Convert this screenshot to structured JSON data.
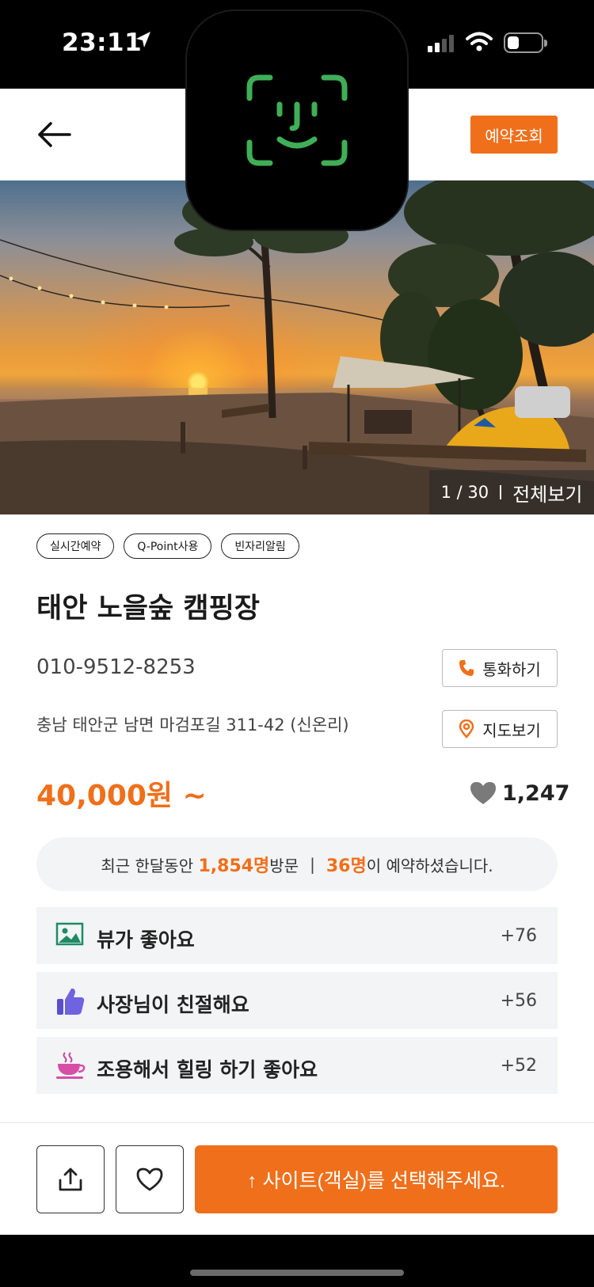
{
  "status_bar": {
    "time": "23:11"
  },
  "header": {
    "reserve_label": "예약조회"
  },
  "gallery": {
    "counter": "1 / 30",
    "view_all": "전체보기"
  },
  "tags": [
    "실시간예약",
    "Q-Point사용",
    "빈자리알림"
  ],
  "place": {
    "title": "태안 노을숲 캠핑장",
    "phone": "010-9512-8253",
    "call_label": "통화하기",
    "address": "충남 태안군 남면 마검포길 311-42 (신온리)",
    "map_label": "지도보기",
    "price": "40,000원 ~",
    "likes": "1,247"
  },
  "stats": {
    "prefix": "최근 한달동안",
    "visitors": "1,854명",
    "visitors_suffix": "방문",
    "separator": "|",
    "reservations": "36명",
    "reservations_suffix": "이 예약하셨습니다."
  },
  "reviews": [
    {
      "label": "뷰가 좋아요",
      "count": "+76",
      "icon": "picture-icon"
    },
    {
      "label": "사장님이 친절해요",
      "count": "+56",
      "icon": "thumbs-up-icon"
    },
    {
      "label": "조용해서 힐링 하기 좋아요",
      "count": "+52",
      "icon": "coffee-cup-icon"
    }
  ],
  "bottom": {
    "select_label": "↑ 사이트(객실)를 선택해주세요."
  },
  "colors": {
    "accent": "#f06f1a",
    "review_bg": "#f2f4f5",
    "stats_bg": "#f3f4f6"
  }
}
